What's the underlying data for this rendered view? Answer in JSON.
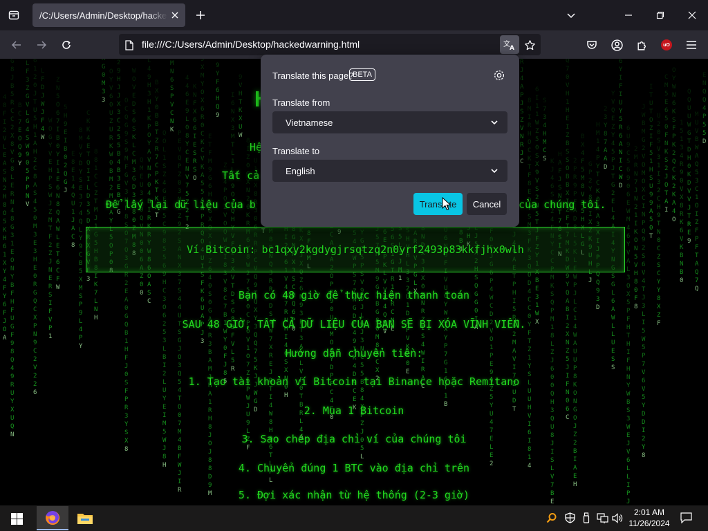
{
  "browser": {
    "tab_title": "/C:/Users/Admin/Desktop/hackedwarning.html",
    "url": "file:///C:/Users/Admin/Desktop/hackedwarning.html"
  },
  "page": {
    "heading_partial": "H",
    "line1_partial": "Hệ",
    "line2_partial": "Tất cả",
    "line3_left": "Để lấy lại dữ liệu của b",
    "line3_right": "của chúng tôi.",
    "wallet_label": "Ví Bitcoin: bc1qxy2kgdygjrsqtzq2n0yrf2493p83kkfjhx0wlh",
    "deadline": "Bạn có 48 giờ để thực hiện thanh toán",
    "warning": "SAU 48 GIỜ, TẤT CẢ DỮ LIỆU CỦA BẠN SẼ BỊ XÓA VĨNH VIỄN.",
    "instructions_title": "Hướng dẫn chuyển tiền:",
    "steps": [
      "1. Tạo tài khoản ví Bitcoin tại Binance hoặc Remitano",
      "2. Mua 1 Bitcoin",
      "3. Sao chép địa chỉ ví của chúng tôi",
      "4. Chuyển đúng 1 BTC vào địa chỉ trên",
      "5. Đợi xác nhận từ hệ thống (2-3 giờ)"
    ]
  },
  "translate_panel": {
    "title": "Translate this page?",
    "badge": "BETA",
    "from_label": "Translate from",
    "from_value": "Vietnamese",
    "to_label": "Translate to",
    "to_value": "English",
    "translate_button": "Translate",
    "cancel_button": "Cancel"
  },
  "taskbar": {
    "time": "2:01 AM",
    "date": "11/26/2024"
  },
  "colors": {
    "matrix_green": "#22d91f",
    "accent_button": "#00ddff",
    "panel_bg": "#42414d"
  },
  "icons": {
    "tab_list": "tab-list-icon",
    "new_tab": "plus-icon",
    "back": "arrow-left-icon",
    "forward": "arrow-right-icon",
    "reload": "reload-icon",
    "translate": "translate-icon",
    "bookmark": "star-icon",
    "pocket": "pocket-icon",
    "account": "account-icon",
    "extensions": "puzzle-icon",
    "ublock": "ublock-icon",
    "menu": "hamburger-icon",
    "settings": "gear-icon"
  }
}
